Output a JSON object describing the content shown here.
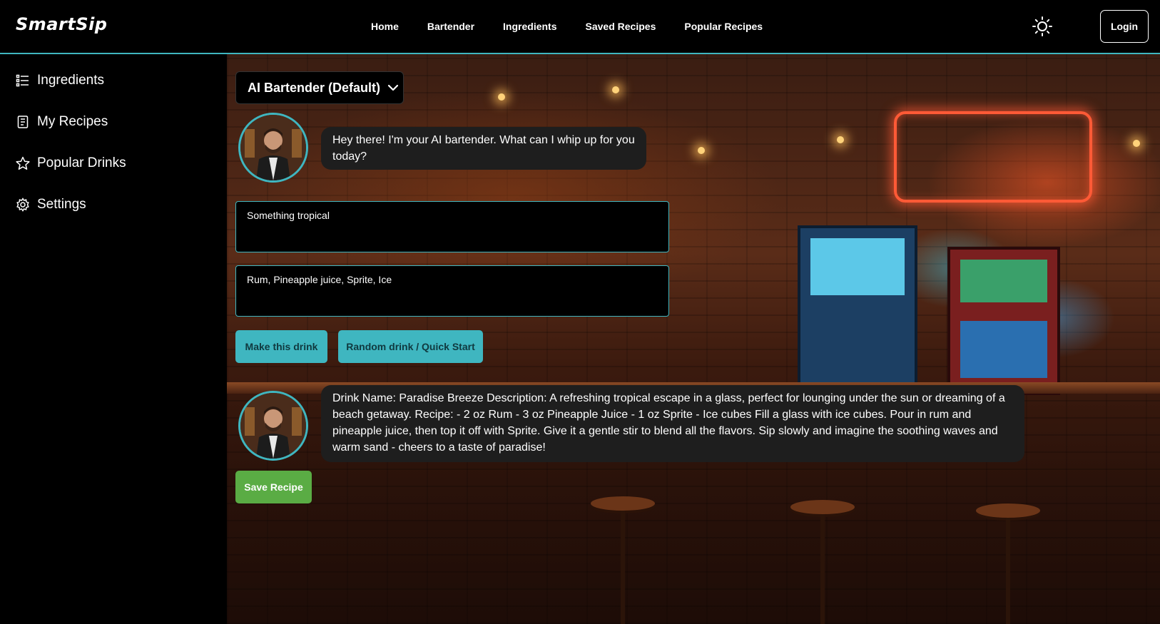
{
  "app": {
    "logo": "SmartSip"
  },
  "nav": {
    "items": [
      "Home",
      "Bartender",
      "Ingredients",
      "Saved Recipes",
      "Popular Recipes"
    ],
    "login_label": "Login",
    "theme_icon": "sun-icon"
  },
  "sidebar": {
    "items": [
      {
        "label": "Ingredients",
        "icon": "list-icon"
      },
      {
        "label": "My Recipes",
        "icon": "recipe-icon"
      },
      {
        "label": "Popular Drinks",
        "icon": "star-icon"
      },
      {
        "label": "Settings",
        "icon": "gear-icon"
      }
    ]
  },
  "bartender": {
    "selected": "AI Bartender (Default)",
    "greeting": "Hey there! I'm your AI bartender. What can I whip up for you today?"
  },
  "inputs": {
    "request": "Something tropical",
    "ingredients": "Rum, Pineapple juice, Sprite, Ice"
  },
  "actions": {
    "make_label": "Make this drink",
    "random_label": "Random drink / Quick Start",
    "save_label": "Save Recipe"
  },
  "response": {
    "text": "Drink Name: Paradise Breeze Description: A refreshing tropical escape in a glass, perfect for lounging under the sun or dreaming of a beach getaway. Recipe: - 2 oz Rum - 3 oz Pineapple Juice - 1 oz Sprite - Ice cubes Fill a glass with ice cubes. Pour in rum and pineapple juice, then top it off with Sprite. Give it a gentle stir to blend all the flavors. Sip slowly and imagine the soothing waves and warm sand - cheers to a taste of paradise!"
  },
  "colors": {
    "accent": "#3fb6c0",
    "save": "#5aac44",
    "bubble": "#1e1e1e",
    "background": "#000000"
  }
}
